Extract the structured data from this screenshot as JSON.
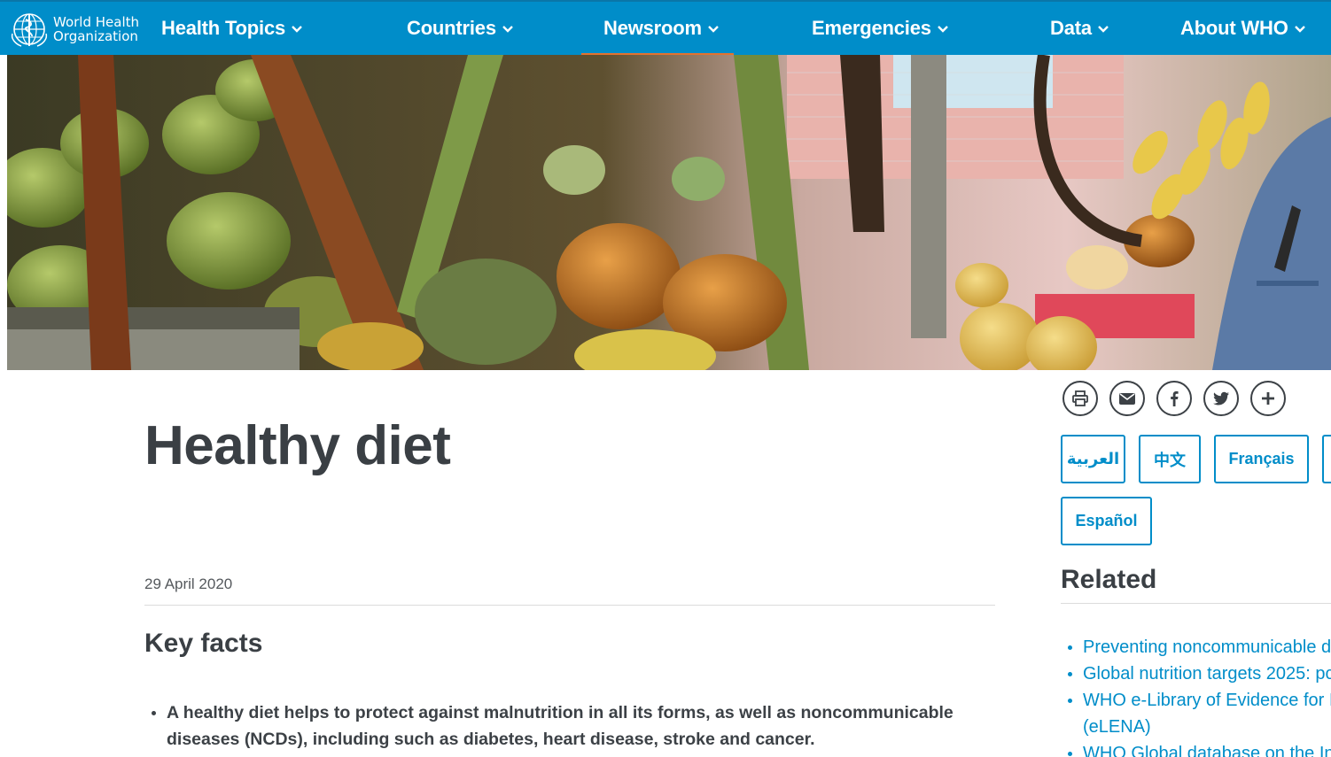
{
  "header": {
    "logo_line1": "World Health",
    "logo_line2": "Organization",
    "nav": [
      {
        "label": "Health Topics",
        "active": false
      },
      {
        "label": "Countries",
        "active": false
      },
      {
        "label": "Newsroom",
        "active": true
      },
      {
        "label": "Emergencies",
        "active": false
      },
      {
        "label": "Data",
        "active": false
      },
      {
        "label": "About WHO",
        "active": false
      }
    ],
    "colors": {
      "bar": "#008dc9",
      "active_underline": "#e3722f"
    }
  },
  "hero": {
    "image": "market stall with coconuts, melons, bananas and produce"
  },
  "main": {
    "title": "Healthy diet",
    "date": "29 April 2020",
    "section_title": "Key facts",
    "facts": [
      "A healthy diet helps to protect against malnutrition in all its forms, as well as noncommunicable diseases (NCDs), including such as diabetes, heart disease, stroke and cancer."
    ]
  },
  "sidebar": {
    "share": [
      {
        "icon": "print-icon"
      },
      {
        "icon": "email-icon"
      },
      {
        "icon": "facebook-icon"
      },
      {
        "icon": "twitter-icon"
      },
      {
        "icon": "plus-icon"
      }
    ],
    "languages": [
      "العربية",
      "中文",
      "Français",
      "Español"
    ],
    "related_title": "Related",
    "related": [
      "Preventing noncommunicable d",
      "Global nutrition targets 2025: pc",
      "WHO e-Library of Evidence for I",
      "(eLENA)",
      "WHO Global database on the In"
    ]
  }
}
